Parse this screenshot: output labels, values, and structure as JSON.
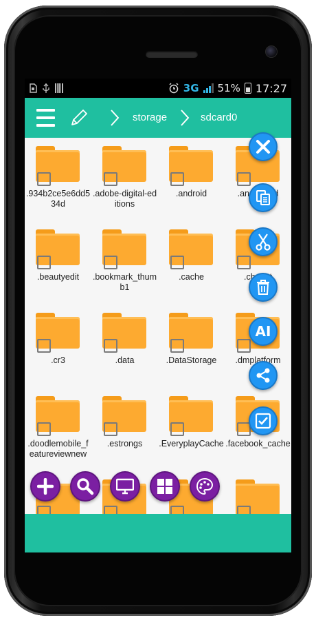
{
  "status_bar": {
    "battery_percent": "51%",
    "time": "17:27",
    "network": "3G",
    "icons": [
      "sim-icon",
      "usb-icon",
      "barcode-icon",
      "alarm-icon",
      "signal-icon",
      "battery-icon"
    ]
  },
  "toolbar": {
    "menu_icon": "hamburger-icon",
    "edit_icon": "pencil-icon",
    "breadcrumbs": [
      "storage",
      "sdcard0"
    ]
  },
  "files": [
    {
      "name": ".934b2ce5e6dd534d"
    },
    {
      "name": ".adobe-digital-editions"
    },
    {
      "name": ".android"
    },
    {
      "name": ".andro...ed"
    },
    {
      "name": ".beautyedit"
    },
    {
      "name": ".bookmark_thumb1"
    },
    {
      "name": ".cache"
    },
    {
      "name": ".char...t"
    },
    {
      "name": ".cr3"
    },
    {
      "name": ".data"
    },
    {
      "name": ".DataStorage"
    },
    {
      "name": ".dmplatform"
    },
    {
      "name": ".doodlemobile_featureviewnew"
    },
    {
      "name": ".estrongs"
    },
    {
      "name": ".EveryplayCache"
    },
    {
      "name": ".facebook_cache"
    },
    {
      "name": ""
    },
    {
      "name": ""
    },
    {
      "name": ""
    },
    {
      "name": ""
    }
  ],
  "side_actions": [
    {
      "icon": "close-icon"
    },
    {
      "icon": "copy-icon"
    },
    {
      "icon": "cut-icon"
    },
    {
      "icon": "delete-icon"
    },
    {
      "icon": "rename-icon",
      "label": "AI"
    },
    {
      "icon": "share-icon"
    },
    {
      "icon": "select-all-icon"
    }
  ],
  "bottom_actions": [
    {
      "icon": "add-icon"
    },
    {
      "icon": "search-icon"
    },
    {
      "icon": "monitor-icon"
    },
    {
      "icon": "grid-view-icon"
    },
    {
      "icon": "palette-icon"
    }
  ],
  "colors": {
    "accent": "#1fbfa0",
    "folder": "#fdaa30",
    "fab_blue": "#2196f3",
    "fab_purple": "#7b1fa2"
  }
}
